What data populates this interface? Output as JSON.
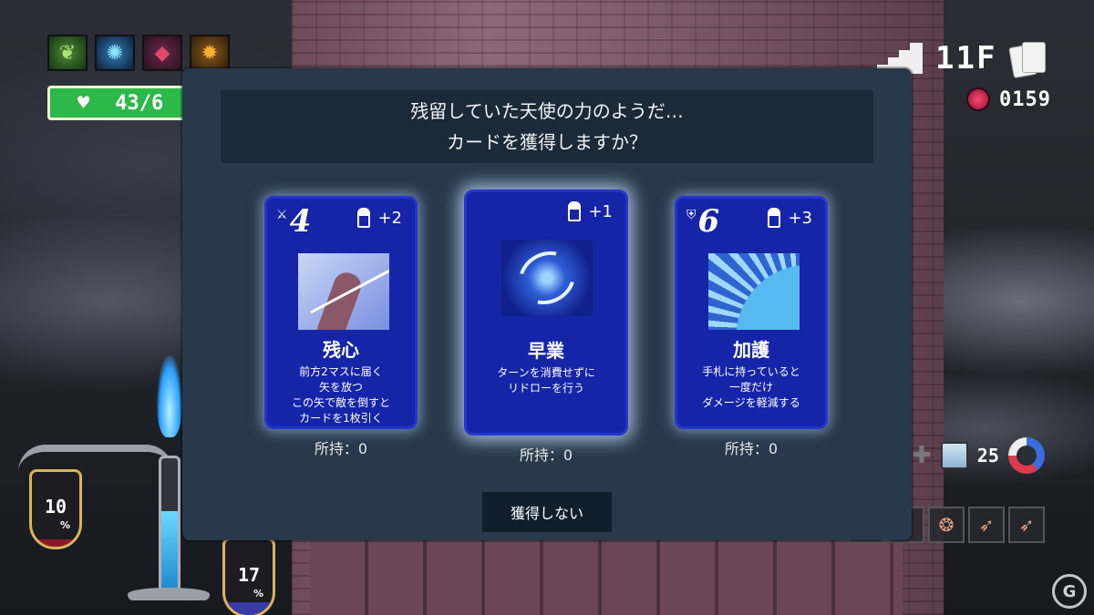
{
  "hud": {
    "status_icons": [
      "herb-icon",
      "magic-circle-icon",
      "shield-icon",
      "sun-icon"
    ],
    "hp_text": "43/6",
    "floor": "11F",
    "gems": "0159",
    "block_count": "25",
    "lamp_gauge_left": {
      "value": "10",
      "unit": "%"
    },
    "lamp_gauge_right": {
      "value": "17",
      "unit": "%"
    }
  },
  "dialog": {
    "message_line1": "残留していた天使の力のようだ…",
    "message_line2": "カードを獲得しますか？",
    "cards": [
      {
        "cost": "4",
        "cost_icon": "sword-icon",
        "charge": "+2",
        "name": "残心",
        "desc": [
          "前方2マスに届く",
          "矢を放つ",
          "この矢で敵を倒すと",
          "カードを1枚引く"
        ],
        "owned": "所持：0"
      },
      {
        "cost": "",
        "charge": "+1",
        "name": "早業",
        "desc": [
          "ターンを消費せずに",
          "リドローを行う"
        ],
        "owned": "所持：0"
      },
      {
        "cost": "6",
        "cost_icon": "shield-icon",
        "charge": "+3",
        "name": "加護",
        "desc": [
          "手札に持っていると",
          "一度だけ",
          "ダメージを軽減する"
        ],
        "owned": "所持：0"
      }
    ],
    "decline_label": "獲得しない"
  }
}
